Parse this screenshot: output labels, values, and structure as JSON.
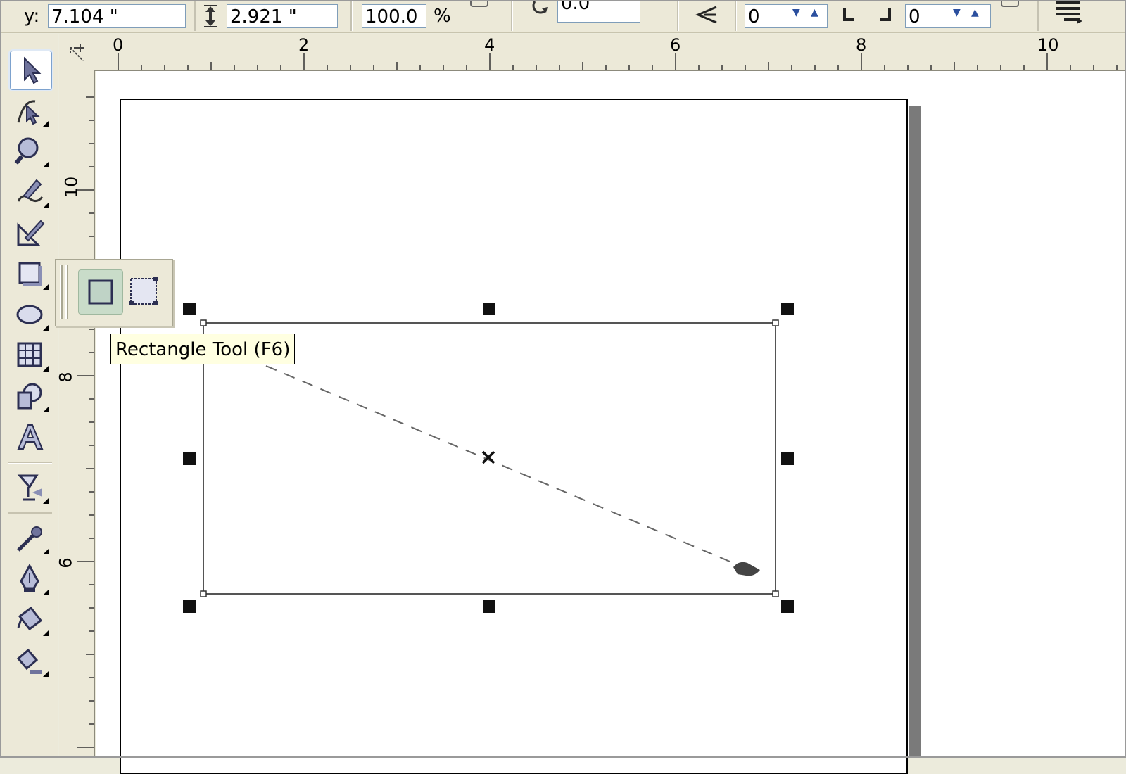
{
  "property_bar": {
    "y_label": "y:",
    "y_value": "7.104 \"",
    "height_value": "2.921 \"",
    "scale_value": "100.0",
    "scale_unit": "%",
    "rotation_value": "0.0",
    "corner_left_value": "0",
    "corner_right_value": "0"
  },
  "toolbox": {
    "tools": [
      {
        "name": "pick-tool",
        "icon": "arrow-icon"
      },
      {
        "name": "shape-tool",
        "icon": "shape-node-icon"
      },
      {
        "name": "zoom-tool",
        "icon": "magnifier-icon"
      },
      {
        "name": "freehand-tool",
        "icon": "pen-curve-icon"
      },
      {
        "name": "smart-fill-tool",
        "icon": "smart-draw-icon"
      },
      {
        "name": "rectangle-tool",
        "icon": "rectangle-icon"
      },
      {
        "name": "ellipse-tool",
        "icon": "ellipse-icon"
      },
      {
        "name": "graph-paper-tool",
        "icon": "grid-icon"
      },
      {
        "name": "basic-shapes-tool",
        "icon": "shapes-icon"
      },
      {
        "name": "text-tool",
        "icon": "text-a-icon"
      },
      {
        "name": "interactive-blend-tool",
        "icon": "blend-glass-icon"
      },
      {
        "name": "eyedropper-tool",
        "icon": "eyedropper-icon"
      },
      {
        "name": "outline-tool",
        "icon": "pen-nib-icon"
      },
      {
        "name": "fill-tool",
        "icon": "paint-bucket-icon"
      },
      {
        "name": "interactive-fill-tool",
        "icon": "interactive-fill-icon"
      }
    ]
  },
  "rulers": {
    "horizontal": [
      "0",
      "2",
      "4",
      "6",
      "8",
      "10"
    ],
    "vertical": [
      "10",
      "8",
      "6"
    ]
  },
  "flyout": {
    "items": [
      {
        "name": "rectangle-tool",
        "icon": "rectangle-icon"
      },
      {
        "name": "3-point-rectangle-tool",
        "icon": "three-point-rectangle-icon"
      }
    ]
  },
  "tooltip": {
    "text": "Rectangle Tool (F6)"
  },
  "colors": {
    "ui_background": "#ece9d8",
    "tooltip_background": "#ffffe1",
    "canvas": "#ffffff",
    "page_shadow": "#7a7a7a"
  }
}
